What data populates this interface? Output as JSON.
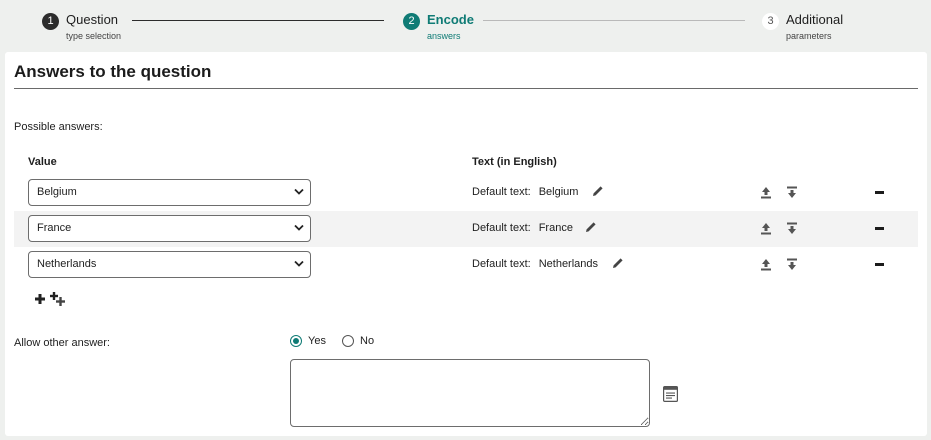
{
  "stepper": {
    "steps": [
      {
        "number": "1",
        "title": "Question",
        "subtitle": "type selection"
      },
      {
        "number": "2",
        "title": "Encode",
        "subtitle": "answers"
      },
      {
        "number": "3",
        "title": "Additional",
        "subtitle": "parameters"
      }
    ],
    "active_step": 2
  },
  "card": {
    "title": "Answers to the question",
    "possible_label": "Possible answers:",
    "col_value": "Value",
    "col_text": "Text (in English)",
    "default_text_label": "Default text:",
    "answers": [
      {
        "value": "Belgium",
        "text": "Belgium"
      },
      {
        "value": "France",
        "text": "France"
      },
      {
        "value": "Netherlands",
        "text": "Netherlands"
      }
    ],
    "allow_other_label": "Allow other answer:",
    "yes_label": "Yes",
    "no_label": "No",
    "allow_other_selected": "Yes",
    "other_text_value": ""
  },
  "icons": {
    "edit": "pencil-icon",
    "move_up": "move-up-icon",
    "move_down": "move-down-icon",
    "remove": "minus-icon",
    "add": "plus-icon",
    "add_multiple": "add-multiple-icon",
    "editor": "text-editor-icon"
  },
  "colors": {
    "accent": "#0f7b75",
    "background": "#eef0ee"
  }
}
